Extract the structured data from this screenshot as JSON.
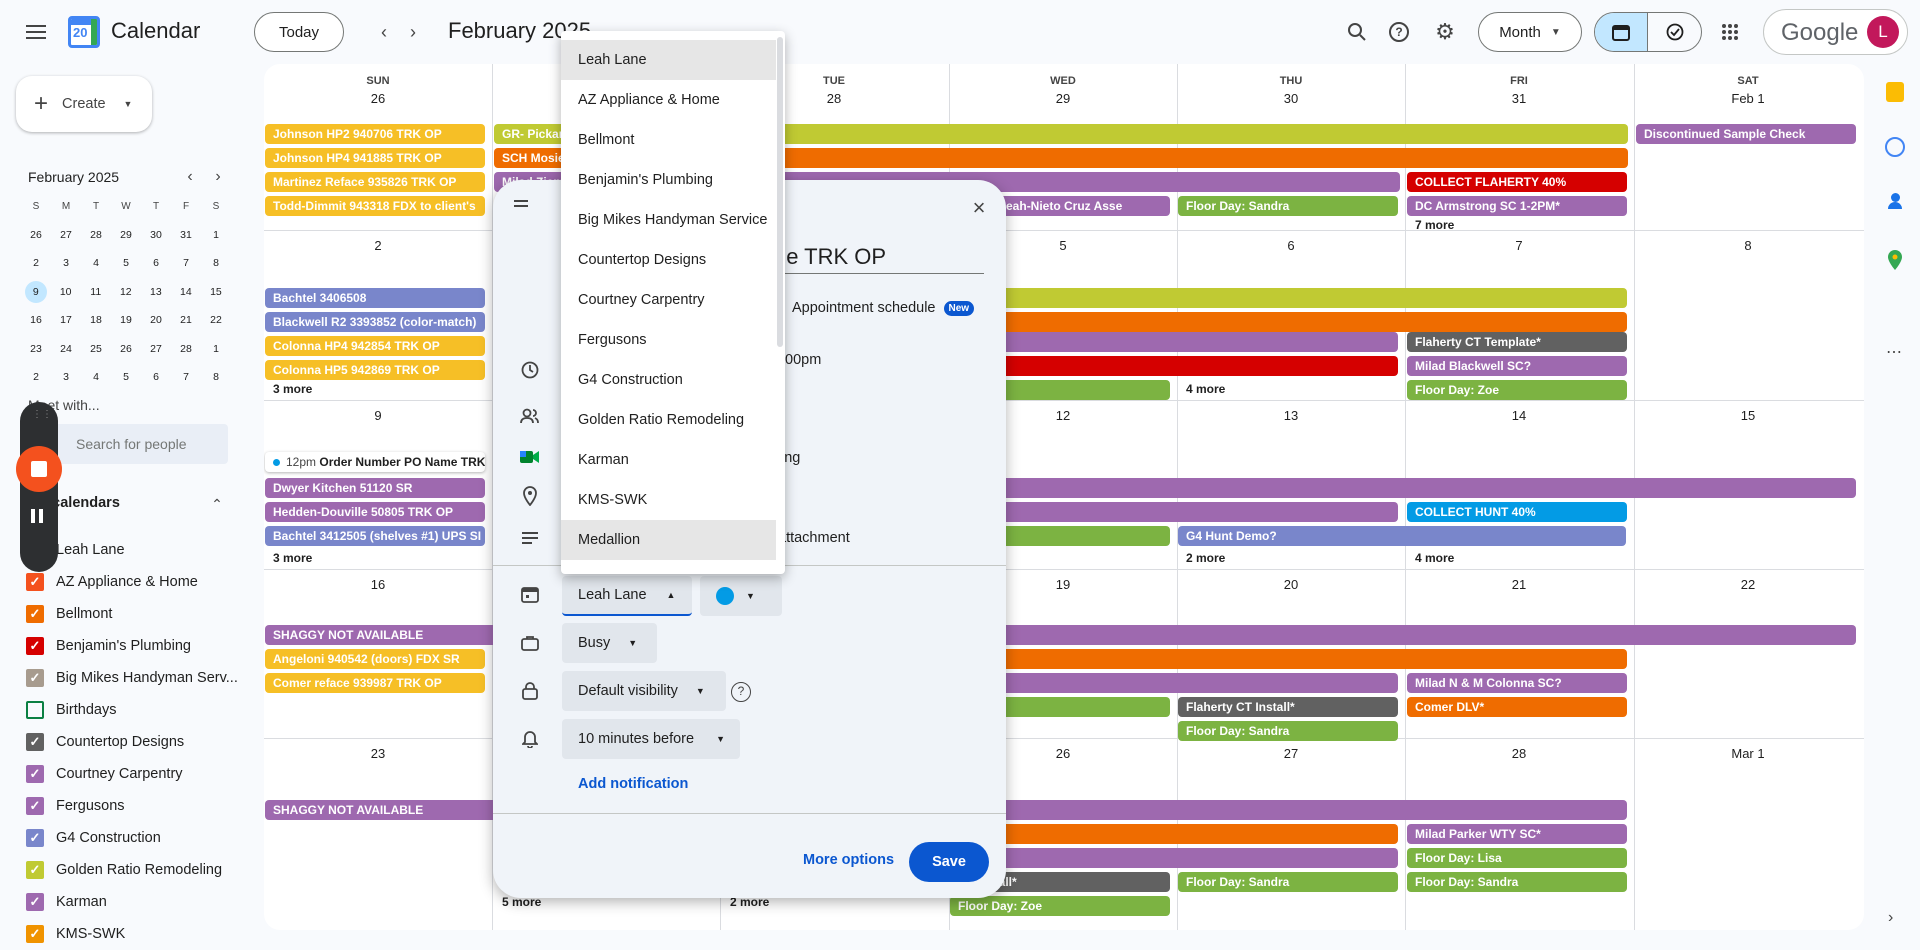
{
  "app": {
    "title": "Calendar",
    "logo_day": "20",
    "month_title": "February 2025",
    "today": "Today",
    "view": "Month",
    "avatar": "L",
    "google": "Google"
  },
  "sidebar": {
    "create": "Create",
    "mini_month": "February 2025",
    "weekdays": [
      "S",
      "M",
      "T",
      "W",
      "T",
      "F",
      "S"
    ],
    "weeks": [
      [
        "26",
        "27",
        "28",
        "29",
        "30",
        "31",
        "1"
      ],
      [
        "2",
        "3",
        "4",
        "5",
        "6",
        "7",
        "8"
      ],
      [
        "9",
        "10",
        "11",
        "12",
        "13",
        "14",
        "15"
      ],
      [
        "16",
        "17",
        "18",
        "19",
        "20",
        "21",
        "22"
      ],
      [
        "23",
        "24",
        "25",
        "26",
        "27",
        "28",
        "1"
      ],
      [
        "2",
        "3",
        "4",
        "5",
        "6",
        "7",
        "8"
      ]
    ],
    "meet_with": "Meet with...",
    "search_people": "Search for people",
    "my_calendars": "My calendars",
    "calendars": [
      {
        "name": "Leah Lane",
        "color": "#039be5",
        "checked": true
      },
      {
        "name": "AZ Appliance & Home",
        "color": "#f4511e",
        "checked": true
      },
      {
        "name": "Bellmont",
        "color": "#ef6c00",
        "checked": true
      },
      {
        "name": "Benjamin's Plumbing",
        "color": "#d50000",
        "checked": true
      },
      {
        "name": "Big Mikes Handyman Serv...",
        "color": "#a79b8e",
        "checked": true
      },
      {
        "name": "Birthdays",
        "color": "#0b8043",
        "checked": false
      },
      {
        "name": "Countertop Designs",
        "color": "#616161",
        "checked": true
      },
      {
        "name": "Courtney Carpentry",
        "color": "#9e69af",
        "checked": true
      },
      {
        "name": "Fergusons",
        "color": "#9e69af",
        "checked": true
      },
      {
        "name": "G4 Construction",
        "color": "#7986cb",
        "checked": true
      },
      {
        "name": "Golden Ratio Remodeling",
        "color": "#c0ca33",
        "checked": true
      },
      {
        "name": "Karman",
        "color": "#9e69af",
        "checked": true
      },
      {
        "name": "KMS-SWK",
        "color": "#f09300",
        "checked": true
      }
    ]
  },
  "grid": {
    "days": [
      "SUN",
      "MON",
      "TUE",
      "WED",
      "THU",
      "FRI",
      "SAT"
    ],
    "dates": [
      [
        "26",
        "27",
        "28",
        "29",
        "30",
        "31",
        "Feb 1"
      ],
      [
        "2",
        "3",
        "4",
        "5",
        "6",
        "7",
        "8"
      ],
      [
        "9",
        "10",
        "11",
        "12",
        "13",
        "14",
        "15"
      ],
      [
        "16",
        "17",
        "18",
        "19",
        "20",
        "21",
        "22"
      ],
      [
        "23",
        "24",
        "25",
        "26",
        "27",
        "28",
        "Mar 1"
      ]
    ],
    "events": [
      {
        "t": "Johnson HP2 940706 TRK OP",
        "c": "#f6bf26"
      },
      {
        "t": "Johnson HP4 941885 TRK OP",
        "c": "#f6bf26"
      },
      {
        "t": "Martinez Reface 935826 TRK OP",
        "c": "#f6bf26"
      },
      {
        "t": "Todd-Dimmit 943318 FDX to client's",
        "c": "#f6bf26"
      },
      {
        "t": "GR- Pickard",
        "c": "#c0ca33"
      },
      {
        "t": "SCH Mosier",
        "c": "#ef6c00"
      },
      {
        "t": "Milad Zient",
        "c": "#9e69af"
      },
      {
        "t": "Discontinued Sample Check",
        "c": "#9e69af"
      },
      {
        "t": "COLLECT FLAHERTY 40%",
        "c": "#d50000"
      },
      {
        "t": "ered & Leah-Nieto Cruz Asse",
        "c": "#9e69af"
      },
      {
        "t": "Floor Day: Sandra",
        "c": "#7cb342"
      },
      {
        "t": "DC Armstrong SC 1-2PM*",
        "c": "#9e69af"
      },
      {
        "t": "Bachtel 3406508",
        "c": "#7986cb"
      },
      {
        "t": "Blackwell R2 3393852 (color-match)",
        "c": "#7986cb"
      },
      {
        "t": "Colonna HP4 942854 TRK OP",
        "c": "#f6bf26"
      },
      {
        "t": "Colonna HP5 942869 TRK OP",
        "c": "#f6bf26"
      },
      {
        "t": "Flaherty CT Template*",
        "c": "#616161"
      },
      {
        "t": "Milad Blackwell SC?",
        "c": "#9e69af"
      },
      {
        "t": "ay: Zoe",
        "c": "#7cb342"
      },
      {
        "t": "Floor Day: Zoe",
        "c": "#7cb342"
      },
      {
        "t": "Dwyer Kitchen 51120 SR",
        "c": "#9e69af"
      },
      {
        "t": "Hedden-Douville 50805 TRK OP",
        "c": "#9e69af"
      },
      {
        "t": "Bachtel 3412505 (shelves #1) UPS SI",
        "c": "#7986cb"
      },
      {
        "t": "COLLECT HUNT 40%",
        "c": "#039be5"
      },
      {
        "t": "ay: Zoe",
        "c": "#7cb342"
      },
      {
        "t": "G4 Hunt Demo?",
        "c": "#7986cb"
      },
      {
        "t": "SHAGGY NOT AVAILABLE",
        "c": "#9e69af"
      },
      {
        "t": "Angeloni 940542 (doors) FDX SR",
        "c": "#f6bf26"
      },
      {
        "t": "Comer reface 939987 TRK OP",
        "c": "#f6bf26"
      },
      {
        "t": "Milad N & M Colonna SC?",
        "c": "#9e69af"
      },
      {
        "t": "ay: Zoe",
        "c": "#7cb342"
      },
      {
        "t": "Flaherty CT Install*",
        "c": "#616161"
      },
      {
        "t": "Comer DLV*",
        "c": "#ef6c00"
      },
      {
        "t": "Floor Day: Sandra",
        "c": "#7cb342"
      },
      {
        "t": "SHAGGY NOT AVAILABLE",
        "c": "#9e69af"
      },
      {
        "t": "Milad Parker WTY SC*",
        "c": "#9e69af"
      },
      {
        "t": "Floor Day: Lisa",
        "c": "#7cb342"
      },
      {
        "t": "CT Install*",
        "c": "#616161"
      },
      {
        "t": "Floor Day: Sandra",
        "c": "#7cb342"
      },
      {
        "t": "Floor Day: Sandra",
        "c": "#7cb342"
      },
      {
        "t": "Floor Day: Zoe",
        "c": "#7cb342"
      }
    ],
    "timed_event": {
      "time": "12pm",
      "title": "Order Number PO Name TRK"
    },
    "more": [
      "7 more",
      "3 more",
      "4 more",
      "3 more",
      "2 more",
      "4 more",
      "5 more",
      "2 more"
    ]
  },
  "dialog": {
    "title_partial": "ne TRK OP",
    "appointment": "Appointment schedule",
    "new_badge": "New",
    "time_partial": ":00pm",
    "meeting_partial": "ing",
    "attachment_partial": "attachment",
    "calendar_select": "Leah Lane",
    "busy": "Busy",
    "visibility": "Default visibility",
    "notification": "10 minutes before",
    "add_notification": "Add notification",
    "more_options": "More options",
    "save": "Save"
  },
  "dropdown": {
    "options": [
      "Leah Lane",
      "AZ Appliance & Home",
      "Bellmont",
      "Benjamin's Plumbing",
      "Big Mikes Handyman Service",
      "Countertop Designs",
      "Courtney Carpentry",
      "Fergusons",
      "G4 Construction",
      "Golden Ratio Remodeling",
      "Karman",
      "KMS-SWK",
      "Medallion"
    ]
  },
  "colors": {
    "accent": "#0b57d0",
    "selected_cal": "#039be5"
  }
}
